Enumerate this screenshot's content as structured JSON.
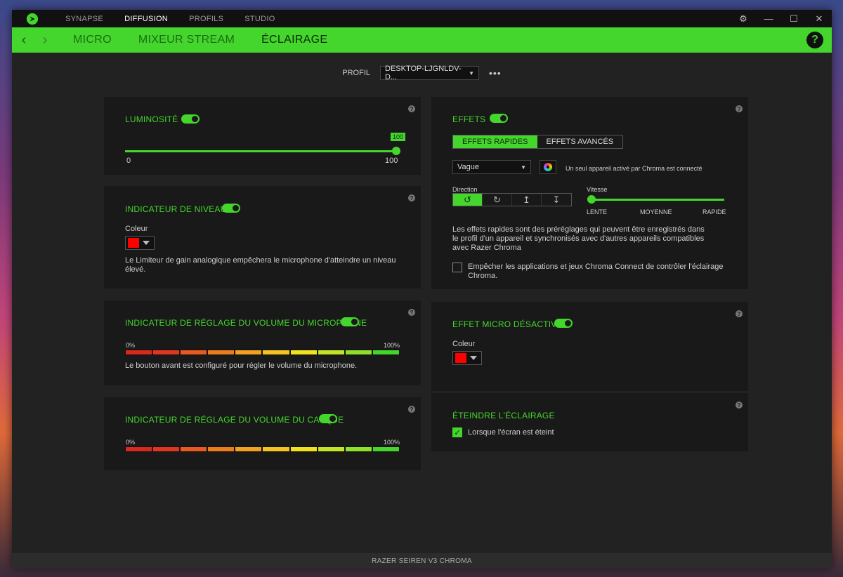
{
  "titlebar": {
    "nav": [
      "SYNAPSE",
      "DIFFUSION",
      "PROFILS",
      "STUDIO"
    ],
    "active_nav": "DIFFUSION",
    "controls": {
      "settings": "⚙",
      "minimize": "—",
      "maximize": "☐",
      "close": "✕"
    }
  },
  "greenbar": {
    "back": "‹",
    "forward": "›",
    "tabs": [
      "MICRO",
      "MIXEUR STREAM",
      "ÉCLAIRAGE"
    ],
    "active_tab": "ÉCLAIRAGE",
    "help": "?"
  },
  "profile": {
    "label": "PROFIL",
    "value": "DESKTOP-LJGNLDV-D...",
    "more": "•••"
  },
  "luminosite": {
    "title": "LUMINOSITÉ",
    "min": "0",
    "max": "100",
    "value_tag": "100",
    "value": 100
  },
  "niveau": {
    "title": "INDICATEUR DE NIVEAU",
    "color_label": "Coleur",
    "desc_line1": "Le Limiteur de gain analogique empêchera le microphone d'atteindre un niveau",
    "desc_line2": "élevé."
  },
  "micvolume": {
    "title": "INDICATEUR DE RÉGLAGE DU VOLUME DU MICROPHONE",
    "min": "0%",
    "max": "100%",
    "desc": "Le bouton avant est configuré pour régler le volume du microphone."
  },
  "casque": {
    "title": "INDICATEUR DE RÉGLAGE DU VOLUME DU CASQUE",
    "min": "0%",
    "max": "100%"
  },
  "effets": {
    "title": "EFFETS",
    "tab_rapides": "EFFETS RAPIDES",
    "tab_avances": "EFFETS AVANCÉS",
    "effect_value": "Vague",
    "chroma_note": "Un seul appareil activé par Chroma est connecté",
    "direction_label": "Direction",
    "vitesse_label": "Vitesse",
    "speed_lente": "LENTE",
    "speed_moyenne": "MOYENNE",
    "speed_rapide": "RAPIDE",
    "speed_value": 0,
    "desc_line1": "Les effets rapides sont des préréglages qui peuvent être enregistrés dans",
    "desc_line2": "le profil d'un appareil et synchronisés avec d'autres appareils compatibles",
    "desc_line3": "avec Razer Chroma",
    "checkbox_line1": "Empêcher les applications et jeux Chroma Connect de contrôler l'éclairage",
    "checkbox_line2": "Chroma."
  },
  "micdesactive": {
    "title": "EFFET MICRO DÉSACTIVÉ",
    "color_label": "Coleur"
  },
  "eteindre": {
    "title": "ÉTEINDRE L'ÉCLAIRAGE",
    "checkbox_label": "Lorsque l'écran est éteint",
    "checked": true
  },
  "footer": {
    "device": "RAZER SEIREN V3 CHROMA"
  },
  "colors": {
    "accent": "#44d62c",
    "panel": "#191919",
    "background": "#222222",
    "swatch_red": "#ff0000"
  }
}
